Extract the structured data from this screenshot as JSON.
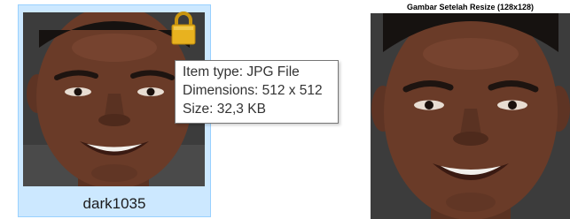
{
  "file_item": {
    "name": "dark1035",
    "locked": true,
    "icon": "lock-icon"
  },
  "tooltip": {
    "item_type": "Item type: JPG File",
    "dimensions": "Dimensions: 512 x 512",
    "size": "Size: 32,3 KB"
  },
  "resized_panel": {
    "title": "Gambar Setelah Resize (128x128)"
  },
  "colors": {
    "selection_fill": "#cce8ff",
    "selection_border": "#99d1ff",
    "lock_gold": "#e8b21f",
    "tooltip_border": "#767676"
  }
}
